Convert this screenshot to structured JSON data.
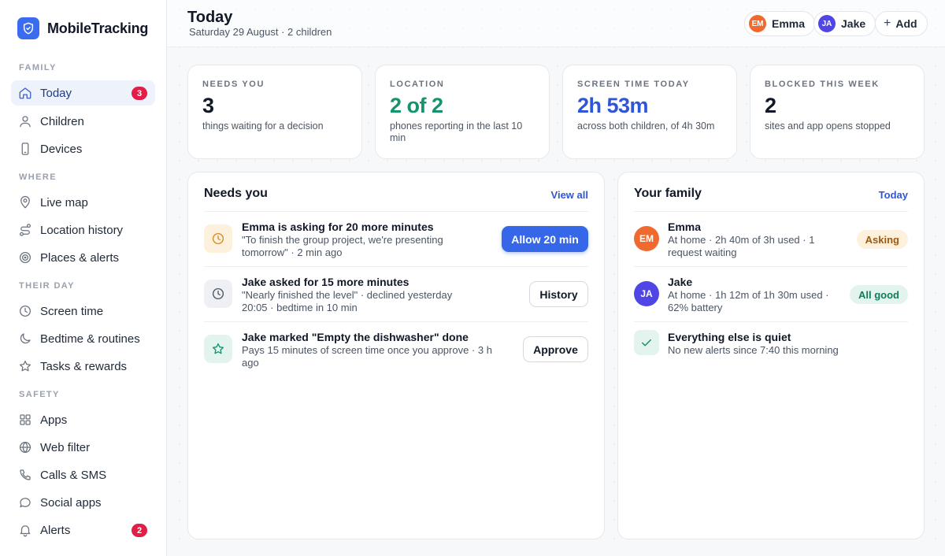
{
  "app": {
    "name": "MobileTracking"
  },
  "sidebar": {
    "sections": [
      {
        "label": "FAMILY"
      },
      {
        "label": "WHERE"
      },
      {
        "label": "THEIR DAY"
      },
      {
        "label": "SAFETY"
      }
    ],
    "items": [
      {
        "label": "Today",
        "icon": "home-icon",
        "badge": "3",
        "active": true
      },
      {
        "label": "Children",
        "icon": "user-icon"
      },
      {
        "label": "Devices",
        "icon": "phone-icon"
      },
      {
        "label": "Live map",
        "icon": "map-pin-icon"
      },
      {
        "label": "Location history",
        "icon": "route-icon"
      },
      {
        "label": "Places & alerts",
        "icon": "target-icon"
      },
      {
        "label": "Screen time",
        "icon": "clock-icon"
      },
      {
        "label": "Bedtime & routines",
        "icon": "moon-icon"
      },
      {
        "label": "Tasks & rewards",
        "icon": "star-icon"
      },
      {
        "label": "Apps",
        "icon": "grid-icon"
      },
      {
        "label": "Web filter",
        "icon": "globe-icon"
      },
      {
        "label": "Calls & SMS",
        "icon": "call-icon"
      },
      {
        "label": "Social apps",
        "icon": "chat-icon"
      },
      {
        "label": "Alerts",
        "icon": "bell-icon",
        "badge": "2"
      }
    ]
  },
  "header": {
    "title": "Today",
    "subtitle": "Saturday 29 August · 2 children",
    "children_chips": [
      {
        "initials": "EM",
        "name": "Emma",
        "color": "#f06a2f"
      },
      {
        "initials": "JA",
        "name": "Jake",
        "color": "#4f46e5"
      }
    ],
    "add_label": "Add"
  },
  "stats": [
    {
      "label": "NEEDS YOU",
      "value": "3",
      "desc": "things waiting for a decision",
      "color": "#111827"
    },
    {
      "label": "LOCATION",
      "value": "2 of 2",
      "desc": "phones reporting in the last 10 min",
      "color": "#15936f"
    },
    {
      "label": "SCREEN TIME TODAY",
      "value": "2h 53m",
      "desc": "across both children, of 4h 30m",
      "color": "#2f56d6"
    },
    {
      "label": "BLOCKED THIS WEEK",
      "value": "2",
      "desc": "sites and app opens stopped",
      "color": "#111827"
    }
  ],
  "needs_you": {
    "title": "Needs you",
    "link": "View all",
    "requests": [
      {
        "title": "Emma is asking for 20 more minutes",
        "desc": "\"To finish the group project, we're presenting tomorrow\" · 2 min ago",
        "action": "Allow 20 min",
        "icon": "clock-icon"
      },
      {
        "title": "Jake asked for 15 more minutes",
        "desc": "\"Nearly finished the level\" · declined yesterday 20:05 · bedtime in 10 min",
        "action": "History",
        "icon": "clock-icon"
      },
      {
        "title": "Jake marked \"Empty the dishwasher\" done",
        "desc": "Pays 15 minutes of screen time once you approve · 3 h ago",
        "action": "Approve",
        "icon": "star-icon"
      }
    ]
  },
  "family": {
    "title": "Your family",
    "link": "Today",
    "members": [
      {
        "initials": "EM",
        "name": "Emma",
        "desc": "At home · 2h 40m of 3h used · 1 request waiting",
        "status": "Asking"
      },
      {
        "initials": "JA",
        "name": "Jake",
        "desc": "At home · 1h 12m of 1h 30m used · 62% battery",
        "status": "All good"
      }
    ],
    "quiet": {
      "title": "Everything else is quiet",
      "desc": "No new alerts since 7:40 this morning"
    }
  }
}
